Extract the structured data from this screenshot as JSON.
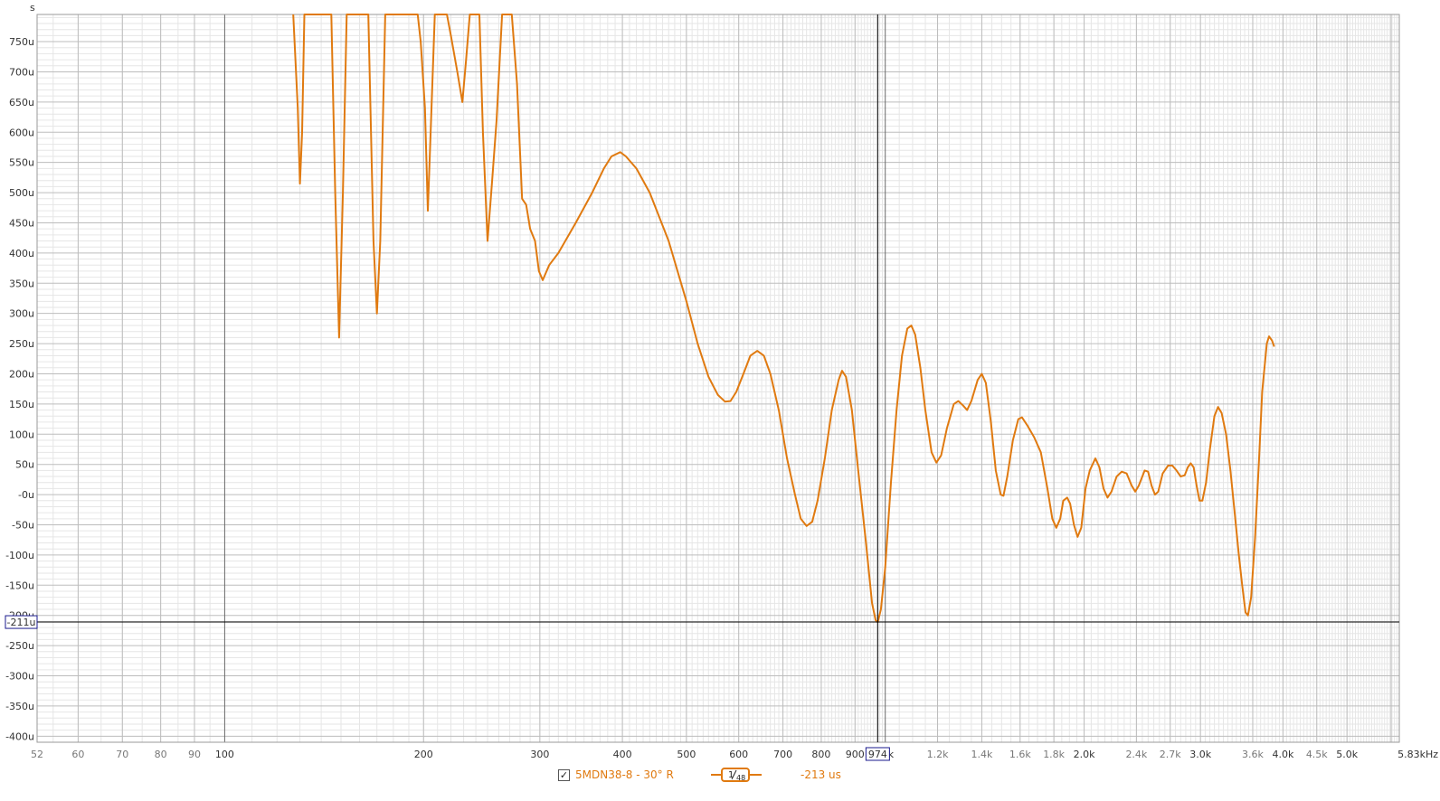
{
  "y_unit": "s",
  "cursor": {
    "y_readout": "-211u",
    "x_readout": "974",
    "x_freq": 974,
    "y_value": -211
  },
  "legend": {
    "checked": true,
    "check_mark": "✓",
    "series_name": "5MDN38-8 - 30° R",
    "smoothing_num": "1",
    "smoothing_den": "48",
    "value": "-213 us"
  },
  "colors": {
    "trace": "#e07a10",
    "grid_major": "#bdbdbd",
    "grid_minor": "#e6e6e6",
    "cursor": "#000000",
    "readout_box": "#1a1a8c"
  },
  "chart_data": {
    "type": "line",
    "x_scale": "log",
    "xlim": [
      52,
      6000
    ],
    "ylim": [
      -410,
      795
    ],
    "y_ticks": [
      {
        "v": 750,
        "label": "750u"
      },
      {
        "v": 700,
        "label": "700u"
      },
      {
        "v": 650,
        "label": "650u"
      },
      {
        "v": 600,
        "label": "600u"
      },
      {
        "v": 550,
        "label": "550u"
      },
      {
        "v": 500,
        "label": "500u"
      },
      {
        "v": 450,
        "label": "450u"
      },
      {
        "v": 400,
        "label": "400u"
      },
      {
        "v": 350,
        "label": "350u"
      },
      {
        "v": 300,
        "label": "300u"
      },
      {
        "v": 250,
        "label": "250u"
      },
      {
        "v": 200,
        "label": "200u"
      },
      {
        "v": 150,
        "label": "150u"
      },
      {
        "v": 100,
        "label": "100u"
      },
      {
        "v": 50,
        "label": "50u"
      },
      {
        "v": 0,
        "label": "-0u"
      },
      {
        "v": -50,
        "label": "-50u"
      },
      {
        "v": -100,
        "label": "-100u"
      },
      {
        "v": -150,
        "label": "-150u"
      },
      {
        "v": -200,
        "label": "-200u"
      },
      {
        "v": -250,
        "label": "-250u"
      },
      {
        "v": -300,
        "label": "-300u"
      },
      {
        "v": -350,
        "label": "-350u"
      },
      {
        "v": -400,
        "label": "-400u"
      }
    ],
    "x_ticks": [
      {
        "v": 52,
        "label": "52",
        "major": false
      },
      {
        "v": 60,
        "label": "60",
        "major": false
      },
      {
        "v": 70,
        "label": "70",
        "major": false
      },
      {
        "v": 80,
        "label": "80",
        "major": false
      },
      {
        "v": 90,
        "label": "90",
        "major": false
      },
      {
        "v": 100,
        "label": "100",
        "major": true
      },
      {
        "v": 200,
        "label": "200",
        "major": true
      },
      {
        "v": 300,
        "label": "300",
        "major": true
      },
      {
        "v": 400,
        "label": "400",
        "major": true
      },
      {
        "v": 500,
        "label": "500",
        "major": true
      },
      {
        "v": 600,
        "label": "600",
        "major": true
      },
      {
        "v": 700,
        "label": "700",
        "major": true
      },
      {
        "v": 800,
        "label": "800",
        "major": true
      },
      {
        "v": 900,
        "label": "900",
        "major": true
      },
      {
        "v": 1000,
        "label": "k",
        "major": true
      },
      {
        "v": 1200,
        "label": "1.2k",
        "major": false
      },
      {
        "v": 1400,
        "label": "1.4k",
        "major": false
      },
      {
        "v": 1600,
        "label": "1.6k",
        "major": false
      },
      {
        "v": 1800,
        "label": "1.8k",
        "major": false
      },
      {
        "v": 2000,
        "label": "2.0k",
        "major": true
      },
      {
        "v": 2400,
        "label": "2.4k",
        "major": false
      },
      {
        "v": 2700,
        "label": "2.7k",
        "major": false
      },
      {
        "v": 3000,
        "label": "3.0k",
        "major": true
      },
      {
        "v": 3600,
        "label": "3.6k",
        "major": false
      },
      {
        "v": 4000,
        "label": "4.0k",
        "major": true
      },
      {
        "v": 4500,
        "label": "4.5k",
        "major": false
      },
      {
        "v": 5000,
        "label": "5.0k",
        "major": true
      },
      {
        "v": 5830,
        "label": "5.83kHz",
        "major": true
      }
    ],
    "series": [
      {
        "points": [
          [
            127,
            800
          ],
          [
            129,
            640
          ],
          [
            130,
            515
          ],
          [
            131,
            600
          ],
          [
            132,
            800
          ],
          [
            145,
            800
          ],
          [
            147,
            500
          ],
          [
            149,
            260
          ],
          [
            151,
            500
          ],
          [
            153,
            800
          ],
          [
            165,
            800
          ],
          [
            168,
            420
          ],
          [
            170,
            300
          ],
          [
            172,
            420
          ],
          [
            175,
            800
          ],
          [
            196,
            800
          ],
          [
            198,
            750
          ],
          [
            201,
            640
          ],
          [
            203,
            470
          ],
          [
            205,
            600
          ],
          [
            208,
            800
          ],
          [
            217,
            800
          ],
          [
            220,
            760
          ],
          [
            225,
            700
          ],
          [
            229,
            650
          ],
          [
            232,
            720
          ],
          [
            235,
            800
          ],
          [
            243,
            800
          ],
          [
            246,
            600
          ],
          [
            250,
            420
          ],
          [
            254,
            520
          ],
          [
            258,
            620
          ],
          [
            263,
            800
          ],
          [
            272,
            800
          ],
          [
            277,
            680
          ],
          [
            282,
            490
          ],
          [
            286,
            480
          ],
          [
            290,
            440
          ],
          [
            295,
            420
          ],
          [
            299,
            370
          ],
          [
            303,
            355
          ],
          [
            310,
            380
          ],
          [
            320,
            400
          ],
          [
            340,
            450
          ],
          [
            360,
            500
          ],
          [
            375,
            540
          ],
          [
            385,
            560
          ],
          [
            397,
            567
          ],
          [
            405,
            560
          ],
          [
            420,
            540
          ],
          [
            440,
            500
          ],
          [
            470,
            420
          ],
          [
            500,
            320
          ],
          [
            520,
            250
          ],
          [
            540,
            195
          ],
          [
            558,
            165
          ],
          [
            572,
            154
          ],
          [
            583,
            155
          ],
          [
            595,
            170
          ],
          [
            610,
            200
          ],
          [
            625,
            230
          ],
          [
            640,
            238
          ],
          [
            655,
            230
          ],
          [
            670,
            200
          ],
          [
            690,
            140
          ],
          [
            710,
            60
          ],
          [
            730,
            0
          ],
          [
            745,
            -40
          ],
          [
            760,
            -52
          ],
          [
            775,
            -45
          ],
          [
            790,
            -10
          ],
          [
            810,
            60
          ],
          [
            830,
            140
          ],
          [
            850,
            190
          ],
          [
            860,
            205
          ],
          [
            872,
            195
          ],
          [
            890,
            140
          ],
          [
            910,
            40
          ],
          [
            935,
            -80
          ],
          [
            955,
            -180
          ],
          [
            967,
            -208
          ],
          [
            974,
            -211
          ],
          [
            985,
            -190
          ],
          [
            1000,
            -120
          ],
          [
            1020,
            20
          ],
          [
            1040,
            140
          ],
          [
            1060,
            230
          ],
          [
            1080,
            275
          ],
          [
            1095,
            280
          ],
          [
            1110,
            265
          ],
          [
            1130,
            210
          ],
          [
            1150,
            140
          ],
          [
            1175,
            70
          ],
          [
            1195,
            53
          ],
          [
            1215,
            65
          ],
          [
            1240,
            110
          ],
          [
            1270,
            150
          ],
          [
            1290,
            155
          ],
          [
            1310,
            148
          ],
          [
            1330,
            140
          ],
          [
            1350,
            155
          ],
          [
            1380,
            190
          ],
          [
            1400,
            200
          ],
          [
            1420,
            185
          ],
          [
            1445,
            120
          ],
          [
            1470,
            40
          ],
          [
            1495,
            0
          ],
          [
            1510,
            -2
          ],
          [
            1530,
            30
          ],
          [
            1560,
            90
          ],
          [
            1590,
            125
          ],
          [
            1610,
            128
          ],
          [
            1640,
            115
          ],
          [
            1680,
            95
          ],
          [
            1720,
            70
          ],
          [
            1760,
            10
          ],
          [
            1790,
            -40
          ],
          [
            1815,
            -55
          ],
          [
            1840,
            -40
          ],
          [
            1860,
            -10
          ],
          [
            1885,
            -5
          ],
          [
            1905,
            -15
          ],
          [
            1930,
            -50
          ],
          [
            1955,
            -70
          ],
          [
            1980,
            -55
          ],
          [
            2010,
            10
          ],
          [
            2040,
            40
          ],
          [
            2080,
            60
          ],
          [
            2110,
            45
          ],
          [
            2140,
            10
          ],
          [
            2170,
            -5
          ],
          [
            2200,
            5
          ],
          [
            2240,
            30
          ],
          [
            2280,
            38
          ],
          [
            2320,
            35
          ],
          [
            2360,
            15
          ],
          [
            2390,
            5
          ],
          [
            2420,
            15
          ],
          [
            2470,
            40
          ],
          [
            2500,
            38
          ],
          [
            2530,
            15
          ],
          [
            2560,
            0
          ],
          [
            2590,
            5
          ],
          [
            2630,
            35
          ],
          [
            2680,
            48
          ],
          [
            2720,
            48
          ],
          [
            2760,
            40
          ],
          [
            2800,
            30
          ],
          [
            2840,
            32
          ],
          [
            2870,
            45
          ],
          [
            2900,
            52
          ],
          [
            2930,
            45
          ],
          [
            2960,
            15
          ],
          [
            2990,
            -10
          ],
          [
            3020,
            -10
          ],
          [
            3060,
            20
          ],
          [
            3100,
            75
          ],
          [
            3150,
            130
          ],
          [
            3190,
            145
          ],
          [
            3230,
            135
          ],
          [
            3280,
            100
          ],
          [
            3330,
            40
          ],
          [
            3380,
            -30
          ],
          [
            3430,
            -100
          ],
          [
            3470,
            -150
          ],
          [
            3510,
            -195
          ],
          [
            3540,
            -200
          ],
          [
            3580,
            -170
          ],
          [
            3630,
            -70
          ],
          [
            3680,
            60
          ],
          [
            3720,
            170
          ],
          [
            3780,
            250
          ],
          [
            3810,
            262
          ],
          [
            3850,
            255
          ],
          [
            3880,
            245
          ]
        ]
      }
    ]
  }
}
